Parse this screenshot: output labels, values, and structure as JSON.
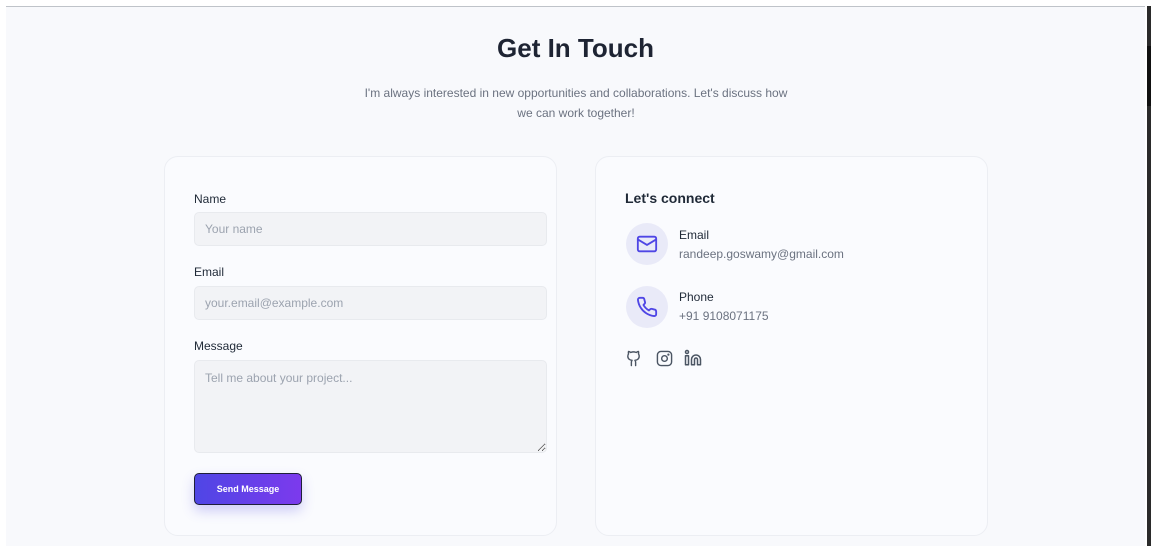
{
  "section": {
    "title": "Get In Touch",
    "subtitle": "I'm always interested in new opportunities and collaborations. Let's discuss how we can work together!"
  },
  "form": {
    "name_label": "Name",
    "name_placeholder": "Your name",
    "name_value": "",
    "email_label": "Email",
    "email_placeholder": "your.email@example.com",
    "email_value": "",
    "message_label": "Message",
    "message_placeholder": "Tell me about your project...",
    "message_value": "",
    "submit_label": "Send Message"
  },
  "contact": {
    "title": "Let's connect",
    "items": [
      {
        "icon": "mail-icon",
        "label": "Email",
        "value": "randeep.goswamy@gmail.com"
      },
      {
        "icon": "phone-icon",
        "label": "Phone",
        "value": "+91 9108071175"
      }
    ],
    "socials": [
      "github-icon",
      "instagram-icon",
      "linkedin-icon"
    ]
  },
  "colors": {
    "accent": "#4f46e5",
    "accent_end": "#7c3aed",
    "background": "#f8f9fc",
    "icon_circle": "#e9eaf8",
    "muted_text": "#6b7280"
  }
}
